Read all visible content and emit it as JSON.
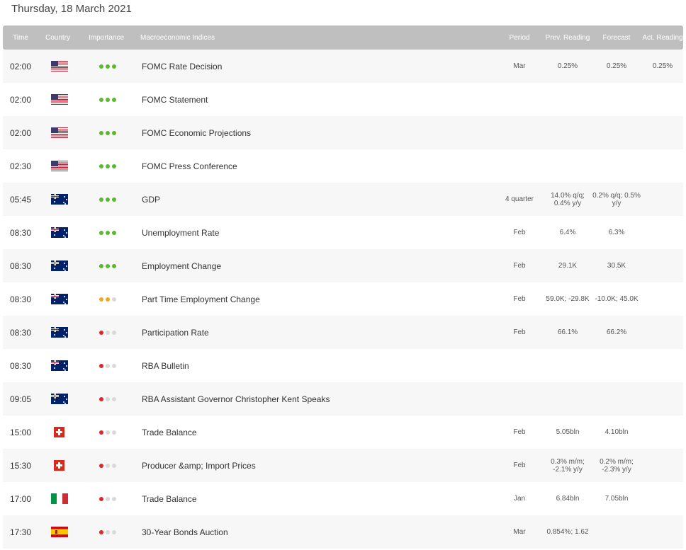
{
  "date_title": "Thursday, 18 March 2021",
  "colors": {
    "high": "#5cb82d",
    "medium": "#f2a81d",
    "low": "#e0262b",
    "inactive": "#d9d9d9"
  },
  "columns": {
    "time": "Time",
    "country": "Country",
    "importance": "Importance",
    "event": "Macroeconomic Indices",
    "period": "Period",
    "prev": "Prev. Reading",
    "forecast": "Forecast",
    "actual": "Act. Reading"
  },
  "rows": [
    {
      "time": "02:00",
      "flag": "us",
      "importance": 3,
      "event": "FOMC Rate Decision",
      "period": "Mar",
      "prev": "0.25%",
      "forecast": "0.25%",
      "actual": "0.25%"
    },
    {
      "time": "02:00",
      "flag": "us",
      "importance": 3,
      "event": "FOMC Statement",
      "period": "",
      "prev": "",
      "forecast": "",
      "actual": ""
    },
    {
      "time": "02:00",
      "flag": "us",
      "importance": 3,
      "event": "FOMC Economic Projections",
      "period": "",
      "prev": "",
      "forecast": "",
      "actual": ""
    },
    {
      "time": "02:30",
      "flag": "us",
      "importance": 3,
      "event": "FOMC Press Conference",
      "period": "",
      "prev": "",
      "forecast": "",
      "actual": ""
    },
    {
      "time": "05:45",
      "flag": "au",
      "importance": 3,
      "event": "GDP",
      "period": "4 quarter",
      "prev": "14.0% q/q; 0.4% y/y",
      "forecast": "0.2% q/q; 0.5% y/y",
      "actual": ""
    },
    {
      "time": "08:30",
      "flag": "au",
      "importance": 3,
      "event": "Unemployment Rate",
      "period": "Feb",
      "prev": "6.4%",
      "forecast": "6.3%",
      "actual": ""
    },
    {
      "time": "08:30",
      "flag": "au",
      "importance": 3,
      "event": "Employment Change",
      "period": "Feb",
      "prev": "29.1K",
      "forecast": "30.5K",
      "actual": ""
    },
    {
      "time": "08:30",
      "flag": "au",
      "importance": 2,
      "event": "Part Time Employment Change",
      "period": "Feb",
      "prev": "59.0K; -29.8K",
      "forecast": "-10.0K; 45.0K",
      "actual": ""
    },
    {
      "time": "08:30",
      "flag": "au",
      "importance": 1,
      "event": "Participation Rate",
      "period": "Feb",
      "prev": "66.1%",
      "forecast": "66.2%",
      "actual": ""
    },
    {
      "time": "08:30",
      "flag": "au",
      "importance": 1,
      "event": "RBA Bulletin",
      "period": "",
      "prev": "",
      "forecast": "",
      "actual": ""
    },
    {
      "time": "09:05",
      "flag": "au",
      "importance": 1,
      "event": "RBA Assistant Governor Christopher Kent Speaks",
      "period": "",
      "prev": "",
      "forecast": "",
      "actual": ""
    },
    {
      "time": "15:00",
      "flag": "ch",
      "importance": 1,
      "event": "Trade Balance",
      "period": "Feb",
      "prev": "5.05bln",
      "forecast": "4.10bln",
      "actual": ""
    },
    {
      "time": "15:30",
      "flag": "ch",
      "importance": 1,
      "event": "Producer &amp; Import Prices",
      "period": "Feb",
      "prev": "0.3% m/m; -2.1% y/y",
      "forecast": "0.2% m/m; -2.3% y/y",
      "actual": ""
    },
    {
      "time": "17:00",
      "flag": "it",
      "importance": 1,
      "event": "Trade Balance",
      "period": "Jan",
      "prev": "6.84bln",
      "forecast": "7.05bln",
      "actual": ""
    },
    {
      "time": "17:30",
      "flag": "es",
      "importance": 1,
      "event": "30-Year Bonds Auction",
      "period": "Mar",
      "prev": "0.854%; 1.62",
      "forecast": "",
      "actual": ""
    }
  ]
}
